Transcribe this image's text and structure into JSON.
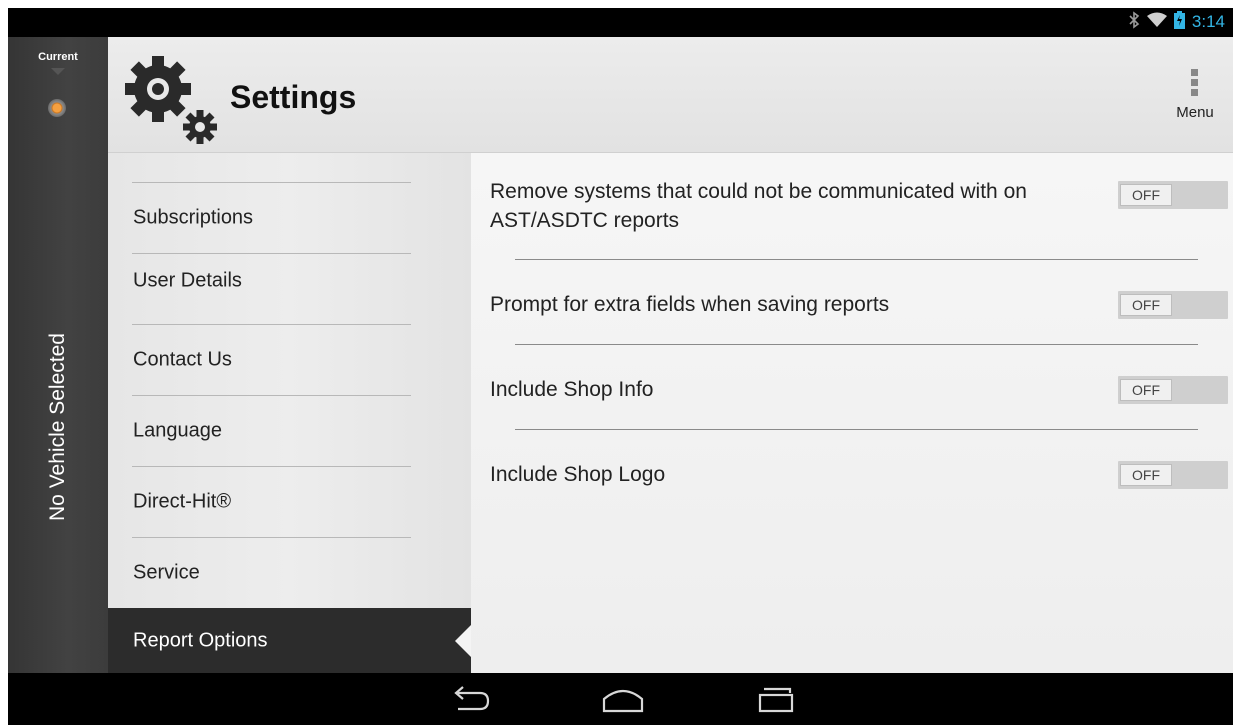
{
  "status_bar": {
    "time": "3:14"
  },
  "vehicle_rail": {
    "current_label": "Current",
    "vertical_text": "No Vehicle Selected"
  },
  "header": {
    "title": "Settings",
    "menu_label": "Menu"
  },
  "nav": {
    "items": [
      {
        "label": "Subscriptions"
      },
      {
        "label": "User Details"
      },
      {
        "label": "Contact Us"
      },
      {
        "label": "Language"
      },
      {
        "label": "Direct-Hit®"
      },
      {
        "label": "Service"
      },
      {
        "label": "Report Options"
      }
    ],
    "active_index": 6
  },
  "options": [
    {
      "label": "Remove systems that could not be communicated with on AST/ASDTC reports",
      "toggle": "OFF"
    },
    {
      "label": "Prompt for extra fields when saving reports",
      "toggle": "OFF"
    },
    {
      "label": "Include Shop Info",
      "toggle": "OFF"
    },
    {
      "label": "Include Shop Logo",
      "toggle": "OFF"
    }
  ],
  "colors": {
    "accent": "#33b5e5",
    "active_nav": "#2c2c2c",
    "rail": "#3a3a3a"
  },
  "icons": {
    "status": [
      "bluetooth-icon",
      "wifi-icon",
      "battery-charging-icon"
    ],
    "header": "settings-gears-icon",
    "menu": "overflow-menu-icon",
    "system_nav": [
      "back-icon",
      "home-icon",
      "recent-apps-icon"
    ]
  }
}
